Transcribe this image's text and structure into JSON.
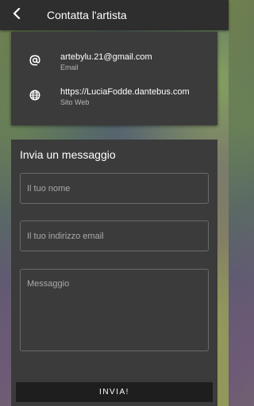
{
  "header": {
    "title": "Contatta l'artista",
    "back_icon": "chevron-left-icon"
  },
  "contacts": [
    {
      "icon": "at-sign-icon",
      "value": "artebylu.21@gmail.com",
      "label": "Email"
    },
    {
      "icon": "globe-icon",
      "value": "https://LuciaFodde.dantebus.com",
      "label": "Sito Web"
    }
  ],
  "message_form": {
    "title": "Invia un messaggio",
    "name_placeholder": "Il tuo nome",
    "email_placeholder": "Il tuo indirizzo email",
    "message_placeholder": "Messaggio",
    "send_label": "INVIA!"
  },
  "colors": {
    "appbar": "#2e2e2e",
    "panel": "#3b3b3b",
    "button": "#1e1e1e"
  }
}
